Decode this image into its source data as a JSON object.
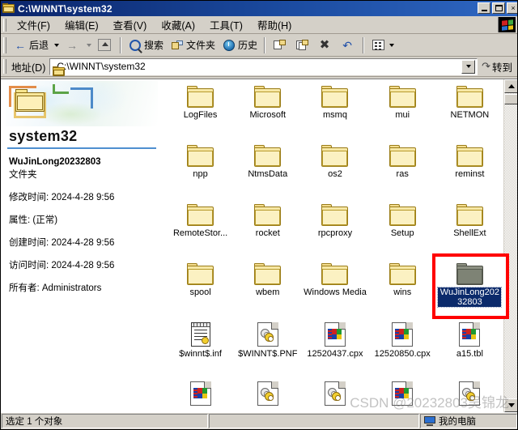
{
  "window": {
    "title": "C:\\WINNT\\system32",
    "title_icon": "folder-icon",
    "minimize_label": "",
    "maximize_label": "",
    "close_label": "×"
  },
  "menu": {
    "items": [
      {
        "label": "文件(F)",
        "name": "menu-file"
      },
      {
        "label": "编辑(E)",
        "name": "menu-edit"
      },
      {
        "label": "查看(V)",
        "name": "menu-view"
      },
      {
        "label": "收藏(A)",
        "name": "menu-favorites"
      },
      {
        "label": "工具(T)",
        "name": "menu-tools"
      },
      {
        "label": "帮助(H)",
        "name": "menu-help"
      }
    ],
    "logo_icon": "windows-logo-icon"
  },
  "toolbar": {
    "back_label": "后退",
    "forward_label": "",
    "up_label": "",
    "search_label": "搜索",
    "folders_label": "文件夹",
    "history_label": "历史",
    "moveto_label": "",
    "copyto_label": "",
    "delete_label": "",
    "undo_label": "",
    "views_label": ""
  },
  "address": {
    "label": "地址(D)",
    "value": "C:\\WINNT\\system32",
    "placeholder": "",
    "go_label": "转到"
  },
  "leftpane": {
    "banner_title": "system32",
    "info_name": "WuJinLong20232803",
    "info_type": "文件夹",
    "modified_label": "修改时间: 2024-4-28 9:56",
    "attributes_label": "属性: (正常)",
    "created_label": "创建时间: 2024-4-28 9:56",
    "accessed_label": "访问时间: 2024-4-28 9:56",
    "owner_label": "所有者: Administrators"
  },
  "grid": {
    "items": [
      {
        "label": "LogFiles",
        "type": "folder"
      },
      {
        "label": "Microsoft",
        "type": "folder"
      },
      {
        "label": "msmq",
        "type": "folder"
      },
      {
        "label": "mui",
        "type": "folder"
      },
      {
        "label": "NETMON",
        "type": "folder"
      },
      {
        "label": "npp",
        "type": "folder"
      },
      {
        "label": "NtmsData",
        "type": "folder"
      },
      {
        "label": "os2",
        "type": "folder"
      },
      {
        "label": "ras",
        "type": "folder"
      },
      {
        "label": "reminst",
        "type": "folder"
      },
      {
        "label": "RemoteStor...",
        "type": "folder"
      },
      {
        "label": "rocket",
        "type": "folder"
      },
      {
        "label": "rpcproxy",
        "type": "folder"
      },
      {
        "label": "Setup",
        "type": "folder"
      },
      {
        "label": "ShellExt",
        "type": "folder"
      },
      {
        "label": "spool",
        "type": "folder"
      },
      {
        "label": "wbem",
        "type": "folder"
      },
      {
        "label": "Windows Media",
        "type": "folder"
      },
      {
        "label": "wins",
        "type": "folder"
      },
      {
        "label": "WuJinLong20232803",
        "type": "folder-dim",
        "selected": true
      },
      {
        "label": "$winnt$.inf",
        "type": "inf"
      },
      {
        "label": "$WINNT$.PNF",
        "type": "gear"
      },
      {
        "label": "12520437.cpx",
        "type": "flag"
      },
      {
        "label": "12520850.cpx",
        "type": "flag"
      },
      {
        "label": "a15.tbl",
        "type": "flag"
      },
      {
        "label": "",
        "type": "flag"
      },
      {
        "label": "",
        "type": "gear"
      },
      {
        "label": "",
        "type": "gear"
      },
      {
        "label": "",
        "type": "flag"
      },
      {
        "label": "",
        "type": "gear"
      }
    ]
  },
  "statusbar": {
    "main": "选定 1 个对象",
    "middle": "",
    "right": "我的电脑",
    "right_icon": "my-computer-icon"
  },
  "watermark": {
    "text": "CSDN @20232803吴锦龙"
  },
  "colors": {
    "titlebar_start": "#0a246a",
    "titlebar_end": "#2f67c2",
    "chrome": "#d4d0c8",
    "selection": "#0b2a6b",
    "highlight_rect": "#ff0000",
    "banner_rule": "#4f8fd0"
  }
}
